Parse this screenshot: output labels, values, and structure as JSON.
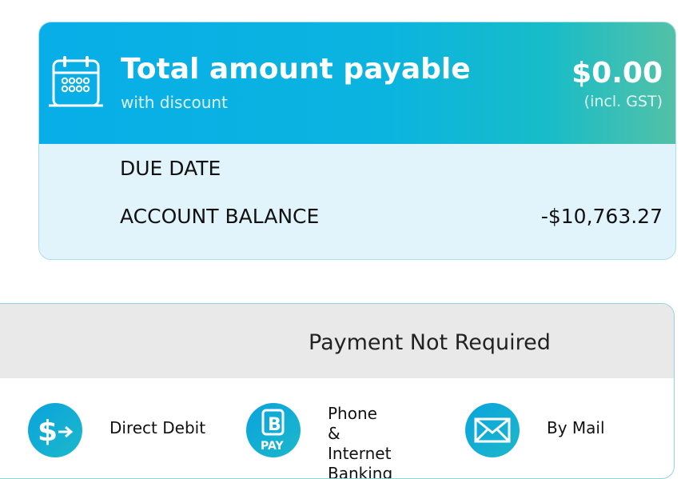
{
  "summary": {
    "title": "Total amount payable",
    "subtitle": "with discount",
    "amount": "$0.00",
    "gst_note": "(incl. GST)",
    "due_date_label": "DUE DATE",
    "account_balance_label": "ACCOUNT BALANCE",
    "account_balance_value": "-$10,763.27",
    "icon": "calendar-icon"
  },
  "payment": {
    "status": "Payment Not Required",
    "methods": [
      {
        "label": "Direct Debit",
        "icon": "direct-debit-icon"
      },
      {
        "label": "Phone &\nInternet\nBanking",
        "icon": "bpay-icon"
      },
      {
        "label": "By Mail",
        "icon": "mail-icon"
      }
    ]
  },
  "colors": {
    "header_start": "#07aee8",
    "header_end": "#53c1a7",
    "body_bg": "#e2f4fb",
    "payment_header_bg": "#e9e9e9",
    "icon_circle": "#0aa3de"
  }
}
